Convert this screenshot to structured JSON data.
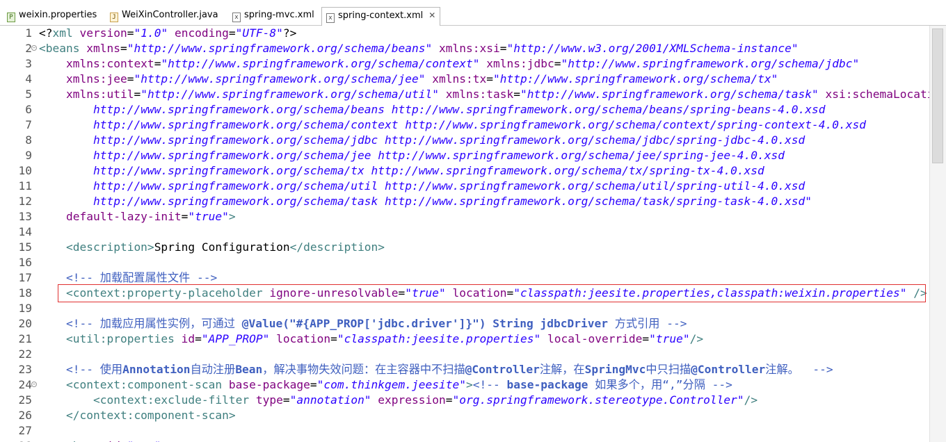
{
  "tabs": [
    {
      "label": "weixin.properties",
      "icon": "P",
      "icon_name": "properties-file-icon"
    },
    {
      "label": "WeiXinController.java",
      "icon": "J",
      "icon_name": "java-file-icon"
    },
    {
      "label": "spring-mvc.xml",
      "icon": "x",
      "icon_name": "xml-file-icon"
    },
    {
      "label": "spring-context.xml",
      "icon": "x",
      "icon_name": "xml-file-icon",
      "active": true,
      "close": "✕"
    }
  ],
  "lines": [
    {
      "n": "1",
      "fold": false,
      "segs": [
        [
          "x",
          "<?"
        ],
        [
          "t",
          "xml"
        ],
        [
          "a",
          " version"
        ],
        [
          "p",
          "="
        ],
        [
          "v",
          "\"1.0\""
        ],
        [
          "a",
          " encoding"
        ],
        [
          "p",
          "="
        ],
        [
          "v",
          "\"UTF-8\""
        ],
        [
          "x",
          "?>"
        ]
      ]
    },
    {
      "n": "2",
      "fold": true,
      "segs": [
        [
          "t",
          "<beans"
        ],
        [
          "a",
          " xmlns"
        ],
        [
          "p",
          "="
        ],
        [
          "v",
          "\"http://www.springframework.org/schema/beans\""
        ],
        [
          "a",
          " xmlns:xsi"
        ],
        [
          "p",
          "="
        ],
        [
          "v",
          "\"http://www.w3.org/2001/XMLSchema-instance\""
        ]
      ]
    },
    {
      "n": "3",
      "fold": false,
      "segs": [
        [
          "p",
          "    "
        ],
        [
          "a",
          "xmlns:context"
        ],
        [
          "p",
          "="
        ],
        [
          "v",
          "\"http://www.springframework.org/schema/context\""
        ],
        [
          "a",
          " xmlns:jdbc"
        ],
        [
          "p",
          "="
        ],
        [
          "v",
          "\"http://www.springframework.org/schema/jdbc\""
        ]
      ]
    },
    {
      "n": "4",
      "fold": false,
      "segs": [
        [
          "p",
          "    "
        ],
        [
          "a",
          "xmlns:jee"
        ],
        [
          "p",
          "="
        ],
        [
          "v",
          "\"http://www.springframework.org/schema/jee\""
        ],
        [
          "a",
          " xmlns:tx"
        ],
        [
          "p",
          "="
        ],
        [
          "v",
          "\"http://www.springframework.org/schema/tx\""
        ]
      ]
    },
    {
      "n": "5",
      "fold": false,
      "segs": [
        [
          "p",
          "    "
        ],
        [
          "a",
          "xmlns:util"
        ],
        [
          "p",
          "="
        ],
        [
          "v",
          "\"http://www.springframework.org/schema/util\""
        ],
        [
          "a",
          " xmlns:task"
        ],
        [
          "p",
          "="
        ],
        [
          "v",
          "\"http://www.springframework.org/schema/task\""
        ],
        [
          "a",
          " xsi:schemaLocation"
        ],
        [
          "p",
          "="
        ],
        [
          "v",
          "\"...\""
        ]
      ]
    },
    {
      "n": "6",
      "fold": false,
      "segs": [
        [
          "p",
          "        "
        ],
        [
          "v",
          "http://www.springframework.org/schema/beans http://www.springframework.org/schema/beans/spring-beans-4.0.xsd"
        ]
      ]
    },
    {
      "n": "7",
      "fold": false,
      "segs": [
        [
          "p",
          "        "
        ],
        [
          "v",
          "http://www.springframework.org/schema/context http://www.springframework.org/schema/context/spring-context-4.0.xsd"
        ]
      ]
    },
    {
      "n": "8",
      "fold": false,
      "segs": [
        [
          "p",
          "        "
        ],
        [
          "v",
          "http://www.springframework.org/schema/jdbc http://www.springframework.org/schema/jdbc/spring-jdbc-4.0.xsd"
        ]
      ]
    },
    {
      "n": "9",
      "fold": false,
      "segs": [
        [
          "p",
          "        "
        ],
        [
          "v",
          "http://www.springframework.org/schema/jee http://www.springframework.org/schema/jee/spring-jee-4.0.xsd"
        ]
      ]
    },
    {
      "n": "10",
      "fold": false,
      "segs": [
        [
          "p",
          "        "
        ],
        [
          "v",
          "http://www.springframework.org/schema/tx http://www.springframework.org/schema/tx/spring-tx-4.0.xsd"
        ]
      ]
    },
    {
      "n": "11",
      "fold": false,
      "segs": [
        [
          "p",
          "        "
        ],
        [
          "v",
          "http://www.springframework.org/schema/util http://www.springframework.org/schema/util/spring-util-4.0.xsd"
        ]
      ]
    },
    {
      "n": "12",
      "fold": false,
      "segs": [
        [
          "p",
          "        "
        ],
        [
          "v",
          "http://www.springframework.org/schema/task http://www.springframework.org/schema/task/spring-task-4.0.xsd\""
        ]
      ]
    },
    {
      "n": "13",
      "fold": false,
      "segs": [
        [
          "p",
          "    "
        ],
        [
          "a",
          "default-lazy-init"
        ],
        [
          "p",
          "="
        ],
        [
          "v",
          "\"true\""
        ],
        [
          "t",
          ">"
        ]
      ]
    },
    {
      "n": "14",
      "fold": false,
      "segs": []
    },
    {
      "n": "15",
      "fold": false,
      "segs": [
        [
          "p",
          "    "
        ],
        [
          "t",
          "<description>"
        ],
        [
          "p",
          "Spring Configuration"
        ],
        [
          "t",
          "</description>"
        ]
      ]
    },
    {
      "n": "16",
      "fold": false,
      "segs": []
    },
    {
      "n": "17",
      "fold": false,
      "segs": [
        [
          "p",
          "    "
        ],
        [
          "c",
          "<!-- 加载配置属性文件 -->"
        ]
      ]
    },
    {
      "n": "18",
      "fold": false,
      "segs": [
        [
          "p",
          "    "
        ],
        [
          "t",
          "<context:property-placeholder"
        ],
        [
          "a",
          " ignore-unresolvable"
        ],
        [
          "p",
          "="
        ],
        [
          "v",
          "\"true\""
        ],
        [
          "a",
          " location"
        ],
        [
          "p",
          "="
        ],
        [
          "v",
          "\"classpath:jeesite.properties,classpath:weixin.properties\""
        ],
        [
          "t",
          " />"
        ]
      ]
    },
    {
      "n": "19",
      "fold": false,
      "segs": []
    },
    {
      "n": "20",
      "fold": false,
      "segs": [
        [
          "p",
          "    "
        ],
        [
          "c",
          "<!-- 加载应用属性实例，可通过 "
        ],
        [
          "cb",
          "@Value(\"#{APP_PROP['jdbc.driver']}\") String jdbcDriver"
        ],
        [
          "c",
          " 方式引用 -->"
        ]
      ]
    },
    {
      "n": "21",
      "fold": false,
      "segs": [
        [
          "p",
          "    "
        ],
        [
          "t",
          "<util:properties"
        ],
        [
          "a",
          " id"
        ],
        [
          "p",
          "="
        ],
        [
          "v",
          "\"APP_PROP\""
        ],
        [
          "a",
          " location"
        ],
        [
          "p",
          "="
        ],
        [
          "v",
          "\"classpath:jeesite.properties\""
        ],
        [
          "a",
          " local-override"
        ],
        [
          "p",
          "="
        ],
        [
          "v",
          "\"true\""
        ],
        [
          "t",
          "/>"
        ]
      ]
    },
    {
      "n": "22",
      "fold": false,
      "segs": []
    },
    {
      "n": "23",
      "fold": false,
      "segs": [
        [
          "p",
          "    "
        ],
        [
          "c",
          "<!-- 使用"
        ],
        [
          "cb",
          "Annotation"
        ],
        [
          "c",
          "自动注册"
        ],
        [
          "cb",
          "Bean"
        ],
        [
          "c",
          "，解决事物失效问题：在主容器中不扫描"
        ],
        [
          "cb",
          "@Controller"
        ],
        [
          "c",
          "注解，在"
        ],
        [
          "cb",
          "SpringMvc"
        ],
        [
          "c",
          "中只扫描"
        ],
        [
          "cb",
          "@Controller"
        ],
        [
          "c",
          "注解。  -->"
        ]
      ]
    },
    {
      "n": "24",
      "fold": true,
      "segs": [
        [
          "p",
          "    "
        ],
        [
          "t",
          "<context:component-scan"
        ],
        [
          "a",
          " base-package"
        ],
        [
          "p",
          "="
        ],
        [
          "v",
          "\"com.thinkgem.jeesite\""
        ],
        [
          "t",
          ">"
        ],
        [
          "c",
          "<!-- "
        ],
        [
          "cb",
          "base-package"
        ],
        [
          "c",
          " 如果多个，用“,”分隔 -->"
        ]
      ]
    },
    {
      "n": "25",
      "fold": false,
      "segs": [
        [
          "p",
          "        "
        ],
        [
          "t",
          "<context:exclude-filter"
        ],
        [
          "a",
          " type"
        ],
        [
          "p",
          "="
        ],
        [
          "v",
          "\"annotation\""
        ],
        [
          "a",
          " expression"
        ],
        [
          "p",
          "="
        ],
        [
          "v",
          "\"org.springframework.stereotype.Controller\""
        ],
        [
          "t",
          "/>"
        ]
      ]
    },
    {
      "n": "26",
      "fold": false,
      "segs": [
        [
          "p",
          "    "
        ],
        [
          "t",
          "</context:component-scan>"
        ]
      ]
    },
    {
      "n": "27",
      "fold": false,
      "segs": []
    },
    {
      "n": "28",
      "fold": false,
      "segs": [
        [
          "p",
          "    "
        ],
        [
          "t",
          "<bean"
        ],
        [
          "a",
          " id"
        ],
        [
          "p",
          "="
        ],
        [
          "v",
          "\"...\""
        ],
        [
          "t",
          ">"
        ]
      ]
    }
  ],
  "colors": {
    "tag": "#3f7f7f",
    "attr": "#7f007f",
    "value": "#2a00ff",
    "comment": "#3f5fbf",
    "highlight": "#e03030"
  }
}
